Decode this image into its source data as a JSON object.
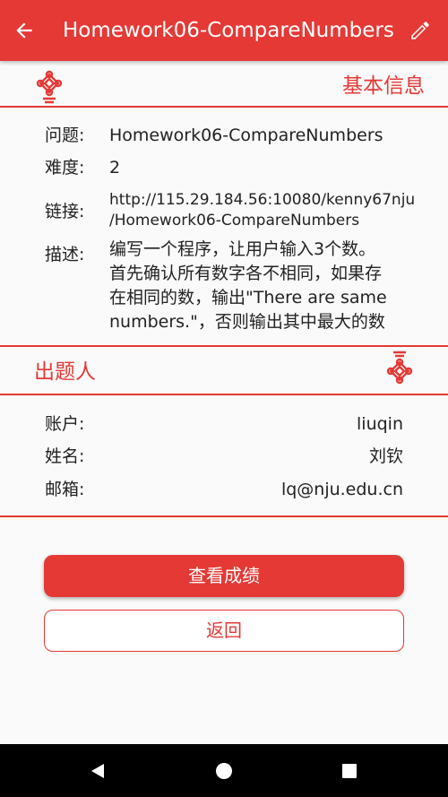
{
  "appbar": {
    "title": "Homework06-CompareNumbers",
    "back_icon": "arrow-left-icon",
    "edit_icon": "pencil-icon"
  },
  "basic_info": {
    "section_title": "基本信息",
    "question_label": "问题:",
    "question_value": "Homework06-CompareNumbers",
    "difficulty_label": "难度:",
    "difficulty_value": "2",
    "link_label": "链接:",
    "link_line1": "http://115.29.184.56:10080/kenny67nju",
    "link_line2": "/Homework06-CompareNumbers",
    "desc_label": "描述:",
    "desc_lines": [
      "编写一个程序，让用户输入3个数。",
      "首先确认所有数字各不相同，如果存",
      "在相同的数，输出\"There are same",
      "numbers.\"，否则输出其中最大的数"
    ]
  },
  "author": {
    "section_title": "出题人",
    "account_label": "账户:",
    "account_value": "liuqin",
    "name_label": "姓名:",
    "name_value": "刘钦",
    "email_label": "邮箱:",
    "email_value": "lq@nju.edu.cn"
  },
  "actions": {
    "view_scores": "查看成绩",
    "back": "返回"
  },
  "colors": {
    "accent": "#e53935",
    "background": "#fafafa",
    "navbar": "#000000"
  }
}
